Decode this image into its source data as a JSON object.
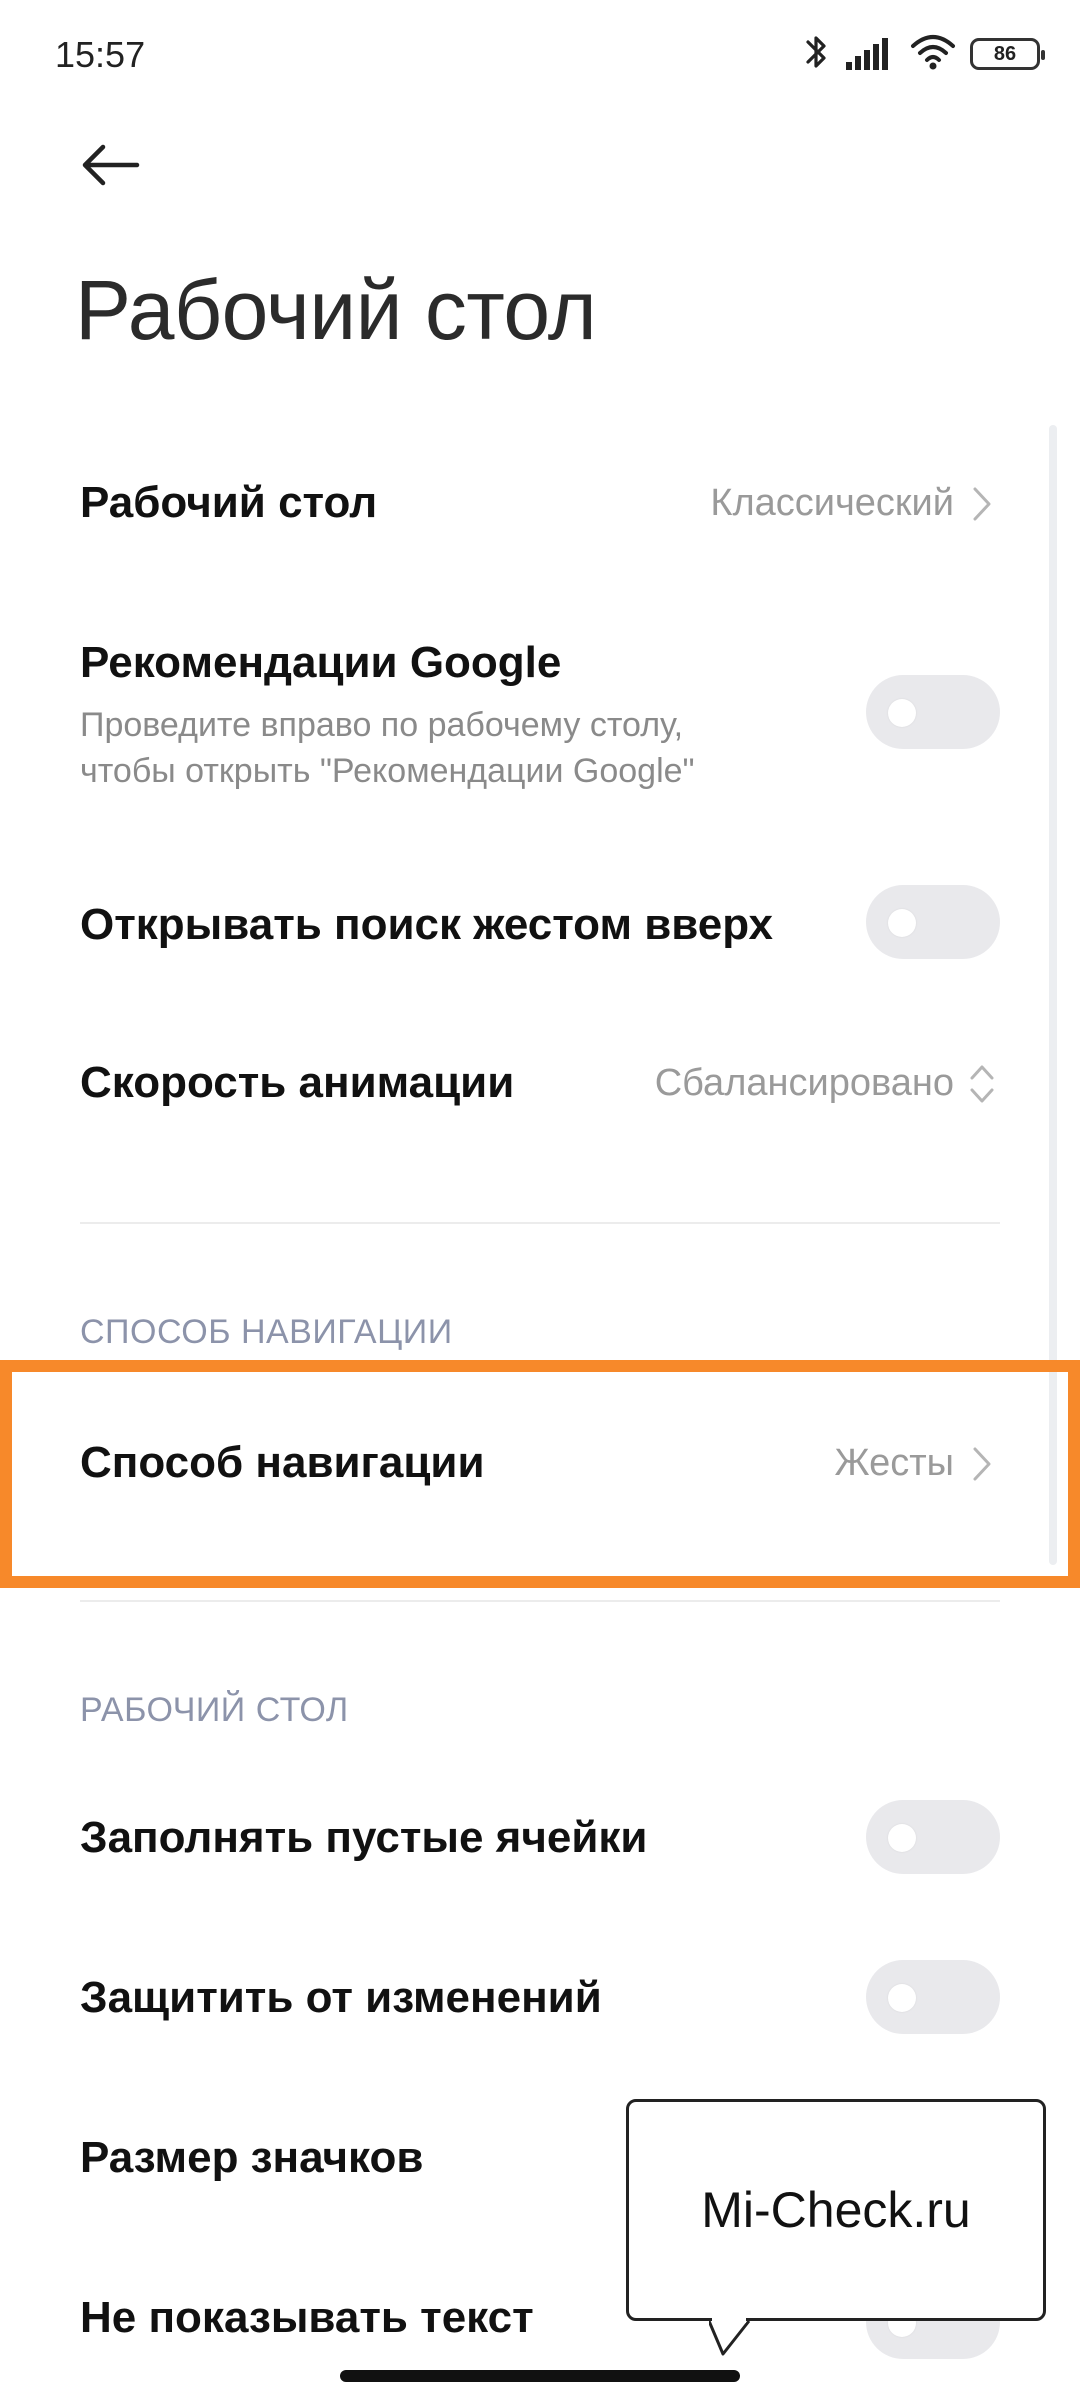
{
  "status_bar": {
    "time": "15:57",
    "battery": "86"
  },
  "header": {
    "title": "Рабочий стол"
  },
  "settings": {
    "home_screen": {
      "label": "Рабочий стол",
      "value": "Классический"
    },
    "google_feed": {
      "label": "Рекомендации Google",
      "subtitle_line1": "Проведите вправо по рабочему столу,",
      "subtitle_line2": "чтобы открыть \"Рекомендации Google\"",
      "enabled": false
    },
    "swipe_search": {
      "label": "Открывать поиск жестом вверх",
      "enabled": false
    },
    "animation_speed": {
      "label": "Скорость анимации",
      "value": "Сбалансировано"
    }
  },
  "navigation_section": {
    "header": "СПОСОБ НАВИГАЦИИ",
    "item": {
      "label": "Способ навигации",
      "value": "Жесты"
    }
  },
  "desktop_section": {
    "header": "РАБОЧИЙ СТОЛ",
    "fill_cells": {
      "label": "Заполнять пустые ячейки",
      "enabled": false
    },
    "lock_layout": {
      "label": "Защитить от изменений",
      "enabled": false
    },
    "icon_size": {
      "label": "Размер значков"
    },
    "hide_text": {
      "label": "Не показывать текст"
    }
  },
  "callout": {
    "text": "Mi-Check.ru"
  },
  "colors": {
    "highlight": "#f7892a",
    "toggle_off": "#e9e9ec",
    "section_header": "#8c93aa"
  }
}
